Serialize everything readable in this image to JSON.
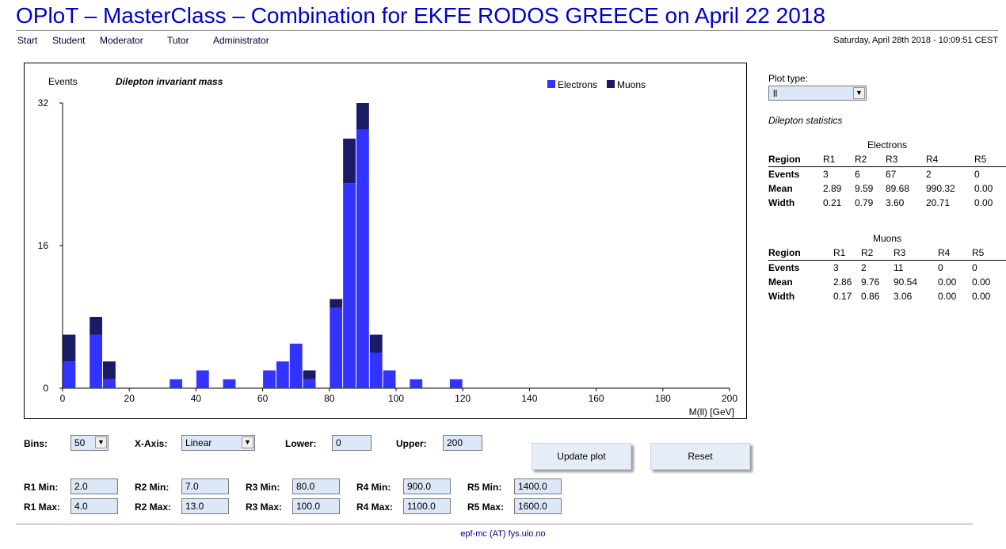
{
  "page_title": "OPloT – MasterClass – Combination for EKFE RODOS GREECE on April 22 2018",
  "nav": [
    {
      "id": "start",
      "label": "Start"
    },
    {
      "id": "student",
      "label": "Student"
    },
    {
      "id": "moderator",
      "label": "Moderator"
    },
    {
      "id": "tutor",
      "label": "Tutor"
    },
    {
      "id": "administrator",
      "label": "Administrator"
    }
  ],
  "datetime": "Saturday, April 28th 2018 - 10:09:51 CEST",
  "chart_data": {
    "type": "bar",
    "title": "Dilepton invariant mass",
    "ylabel": "Events",
    "xlabel": "M(ll) [GeV]",
    "stacked": true,
    "legend_position": "top-right",
    "xlim": [
      0,
      200
    ],
    "ylim": [
      0,
      32
    ],
    "xticks": [
      0,
      20,
      40,
      60,
      80,
      100,
      120,
      140,
      160,
      180,
      200
    ],
    "yticks": [
      0,
      16,
      32
    ],
    "bin_width": 4,
    "bin_starts": [
      0,
      8,
      12,
      32,
      40,
      48,
      60,
      64,
      68,
      72,
      80,
      84,
      88,
      92,
      96,
      104,
      116
    ],
    "series": [
      {
        "name": "Electrons",
        "color": "#3333ff",
        "values": [
          3,
          6,
          1,
          1,
          2,
          1,
          2,
          3,
          5,
          1,
          9,
          23,
          29,
          4,
          2,
          1,
          1
        ]
      },
      {
        "name": "Muons",
        "color": "#1a1a66",
        "values": [
          3,
          2,
          2,
          0,
          0,
          0,
          0,
          0,
          0,
          1,
          1,
          5,
          3,
          2,
          0,
          0,
          0
        ]
      }
    ]
  },
  "sidebar": {
    "plot_type_label": "Plot type:",
    "plot_type_value": "ll",
    "stats_heading": "Dilepton statistics",
    "region_header": [
      "Region",
      "R1",
      "R2",
      "R3",
      "R4",
      "R5"
    ],
    "row_labels": [
      "Events",
      "Mean",
      "Width"
    ],
    "electrons": {
      "caption": "Electrons",
      "rows": [
        [
          "3",
          "6",
          "67",
          "2",
          "0"
        ],
        [
          "2.89",
          "9.59",
          "89.68",
          "990.32",
          "0.00"
        ],
        [
          "0.21",
          "0.79",
          "3.60",
          "20.71",
          "0.00"
        ]
      ]
    },
    "muons": {
      "caption": "Muons",
      "rows": [
        [
          "3",
          "2",
          "11",
          "0",
          "0"
        ],
        [
          "2.86",
          "9.76",
          "90.54",
          "0.00",
          "0.00"
        ],
        [
          "0.17",
          "0.86",
          "3.06",
          "0.00",
          "0.00"
        ]
      ]
    }
  },
  "controls": {
    "bins_label": "Bins:",
    "bins_value": "50",
    "xaxis_label": "X-Axis:",
    "xaxis_value": "Linear",
    "lower_label": "Lower:",
    "lower_value": "0",
    "upper_label": "Upper:",
    "upper_value": "200",
    "update_button": "Update plot",
    "reset_button": "Reset",
    "regions": [
      {
        "min_label": "R1 Min:",
        "min": "2.0",
        "max_label": "R1 Max:",
        "max": "4.0"
      },
      {
        "min_label": "R2 Min:",
        "min": "7.0",
        "max_label": "R2 Max:",
        "max": "13.0"
      },
      {
        "min_label": "R3 Min:",
        "min": "80.0",
        "max_label": "R3 Max:",
        "max": "100.0"
      },
      {
        "min_label": "R4 Min:",
        "min": "900.0",
        "max_label": "R4 Max:",
        "max": "1100.0"
      },
      {
        "min_label": "R5 Min:",
        "min": "1400.0",
        "max_label": "R5 Max:",
        "max": "1600.0"
      }
    ]
  },
  "footer": "epf-mc (AT) fys.uio.no"
}
